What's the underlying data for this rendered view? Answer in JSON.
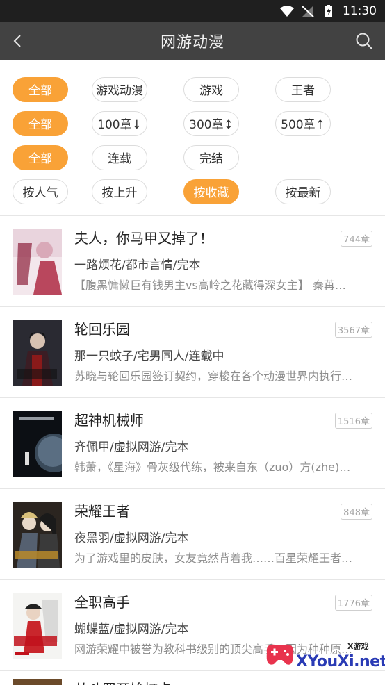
{
  "status_bar": {
    "time": "11:30"
  },
  "app_bar": {
    "title": "网游动漫"
  },
  "filters": {
    "category": [
      "全部",
      "游戏动漫",
      "游戏",
      "王者"
    ],
    "length": [
      "全部",
      "100章↓",
      "300章↕",
      "500章↑"
    ],
    "status": [
      "全部",
      "连载",
      "完结"
    ],
    "sort": [
      "按人气",
      "按上升",
      "按收藏",
      "按最新"
    ],
    "selected": {
      "category": 0,
      "length": 0,
      "status": 0,
      "sort": 2
    }
  },
  "books": [
    {
      "title": "夫人，你马甲又掉了！",
      "meta": "一路烦花/都市言情/完本",
      "desc": "【腹黑慵懒巨有钱男主vs高岭之花藏得深女主】 秦苒…",
      "chapters": "744章"
    },
    {
      "title": "轮回乐园",
      "meta": "那一只蚊子/宅男同人/连载中",
      "desc": "苏晓与轮回乐园签订契约，穿梭在各个动漫世界内执行…",
      "chapters": "3567章"
    },
    {
      "title": "超神机械师",
      "meta": "齐佩甲/虚拟网游/完本",
      "desc": "韩萧，《星海》骨灰级代练，被来自东（zuo）方(zhe)…",
      "chapters": "1516章"
    },
    {
      "title": "荣耀王者",
      "meta": "夜黑羽/虚拟网游/完本",
      "desc": "为了游戏里的皮肤，女友竟然背着我……百星荣耀王者…",
      "chapters": "848章"
    },
    {
      "title": "全职高手",
      "meta": "蝴蝶蓝/虚拟网游/完本",
      "desc": "网游荣耀中被誉为教科书级别的顶尖高手，因为种种原…",
      "chapters": "1776章"
    }
  ],
  "partial_book": {
    "title": "从斗罗开始打卡"
  },
  "watermark": {
    "text": "XYouXi.net",
    "small": "X游戏"
  },
  "colors": {
    "accent": "#f9a237",
    "app_bar": "#424242",
    "status_bar": "#1f1f1f"
  }
}
